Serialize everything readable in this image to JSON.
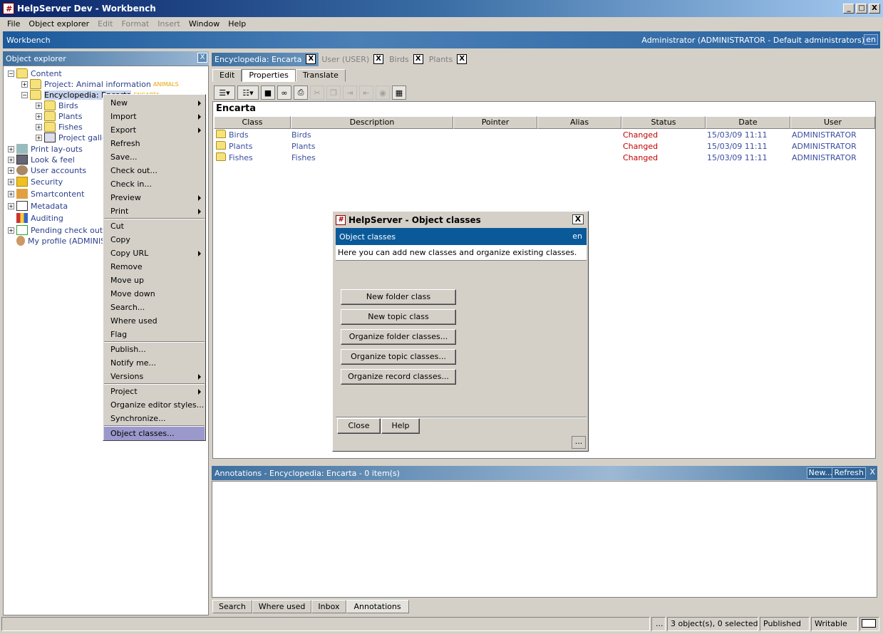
{
  "window": {
    "title": "HelpServer Dev - Workbench",
    "app_icon": "hash-logo-icon",
    "controls": [
      "_",
      "□",
      "X"
    ]
  },
  "menubar": [
    {
      "label": "File",
      "enabled": true
    },
    {
      "label": "Object explorer",
      "enabled": true
    },
    {
      "label": "Edit",
      "enabled": false
    },
    {
      "label": "Format",
      "enabled": false
    },
    {
      "label": "Insert",
      "enabled": false
    },
    {
      "label": "Window",
      "enabled": true
    },
    {
      "label": "Help",
      "enabled": true
    }
  ],
  "workbench": {
    "title": "Workbench",
    "user": "Administrator (ADMINISTRATOR - Default administrators)",
    "lang": "en"
  },
  "explorer": {
    "title": "Object explorer",
    "close": "X",
    "tree": {
      "content": "Content",
      "project": "Project: Animal information",
      "project_tag": "ANIMALS",
      "encyclopedia": "Encyclopedia: Encarta",
      "encyclopedia_tag": "ENCARTA",
      "birds": "Birds",
      "plants": "Plants",
      "fishes": "Fishes",
      "gallery": "Project gallery",
      "print_layouts": "Print lay-outs",
      "look_feel": "Look & feel",
      "user_accounts": "User accounts",
      "security": "Security",
      "smartcontent": "Smartcontent",
      "metadata": "Metadata",
      "auditing": "Auditing",
      "pending": "Pending check outs",
      "profile": "My profile (ADMINISTRATOR)"
    }
  },
  "context_menu": {
    "new": "New",
    "import": "Import",
    "export": "Export",
    "refresh": "Refresh",
    "save": "Save...",
    "checkout": "Check out...",
    "checkin": "Check in...",
    "preview": "Preview",
    "print": "Print",
    "cut": "Cut",
    "copy": "Copy",
    "copyurl": "Copy URL",
    "remove": "Remove",
    "moveup": "Move up",
    "movedown": "Move down",
    "search": "Search...",
    "whereused": "Where used",
    "flag": "Flag",
    "publish": "Publish...",
    "notify": "Notify me...",
    "versions": "Versions",
    "project": "Project",
    "organize": "Organize editor styles...",
    "sync": "Synchronize...",
    "objclasses": "Object classes..."
  },
  "doc_tabs": [
    {
      "label": "Encyclopedia: Encarta",
      "active": true
    },
    {
      "label": "User (USER)",
      "active": false
    },
    {
      "label": "Birds",
      "active": false
    },
    {
      "label": "Plants",
      "active": false
    }
  ],
  "close_x": "X",
  "sub_tabs": [
    "Edit",
    "Properties",
    "Translate"
  ],
  "toolbar_icons": [
    "new-item-dropdown-icon",
    "list-dropdown-icon",
    "save-icon",
    "glasses-icon",
    "print-icon",
    "cut-icon",
    "copy-icon",
    "indent-icon",
    "outdent-icon",
    "globe-icon",
    "grid-icon"
  ],
  "content": {
    "title": "Encarta",
    "columns": [
      "Class",
      "Description",
      "Pointer",
      "Alias",
      "Status",
      "Date",
      "User"
    ],
    "rows": [
      {
        "class": "Birds",
        "description": "Birds",
        "pointer": "",
        "alias": "",
        "status": "Changed",
        "date": "15/03/09 11:11",
        "user": "ADMINISTRATOR"
      },
      {
        "class": "Plants",
        "description": "Plants",
        "pointer": "",
        "alias": "",
        "status": "Changed",
        "date": "15/03/09 11:11",
        "user": "ADMINISTRATOR"
      },
      {
        "class": "Fishes",
        "description": "Fishes",
        "pointer": "",
        "alias": "",
        "status": "Changed",
        "date": "15/03/09 11:11",
        "user": "ADMINISTRATOR"
      }
    ]
  },
  "dialog": {
    "title": "HelpServer - Object classes",
    "header": "Object classes",
    "lang": "en",
    "description": "Here you can add new classes and organize existing classes.",
    "buttons": [
      "New folder class",
      "New topic class",
      "Organize folder classes...",
      "Organize topic classes...",
      "Organize record classes..."
    ],
    "close": "Close",
    "help": "Help",
    "more": "...",
    "x": "X"
  },
  "annotations": {
    "title": "Annotations - Encyclopedia: Encarta - 0 item(s)",
    "new": "New...",
    "refresh": "Refresh",
    "x": "X"
  },
  "bottom_tabs": [
    "Search",
    "Where used",
    "Inbox",
    "Annotations"
  ],
  "statusbar": {
    "more": "...",
    "objects": "3 object(s), 0 selected",
    "state": "Published",
    "mode": "Writable"
  },
  "colors": {
    "title_blue": "#0a246a",
    "panel_blue": "#3d6f9f",
    "changed": "#c00000",
    "link": "#3a4fa0",
    "tag": "#e8a400",
    "selection": "#9b99cc"
  }
}
